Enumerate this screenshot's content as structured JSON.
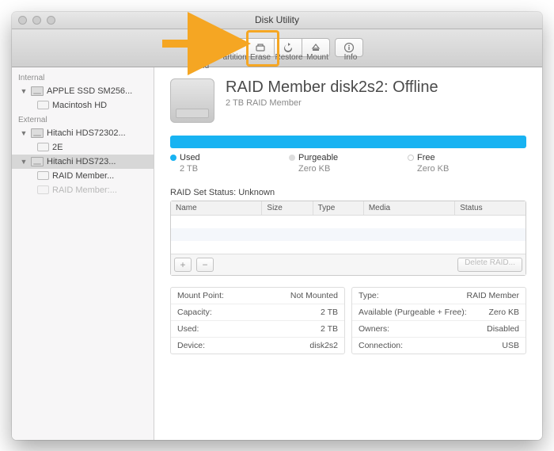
{
  "window": {
    "title": "Disk Utility"
  },
  "toolbar": {
    "items": [
      "First Aid",
      "Partition",
      "Erase",
      "Restore",
      "Mount",
      "Info"
    ]
  },
  "sidebar": {
    "sections": [
      {
        "header": "Internal",
        "items": [
          {
            "label": "APPLE SSD SM256...",
            "type": "disk",
            "children": [
              {
                "label": "Macintosh HD",
                "type": "vol"
              }
            ]
          }
        ]
      },
      {
        "header": "External",
        "items": [
          {
            "label": "Hitachi HDS72302...",
            "type": "disk",
            "children": [
              {
                "label": "2E",
                "type": "vol"
              }
            ]
          },
          {
            "label": "Hitachi HDS723...",
            "type": "disk",
            "selected": true,
            "children": [
              {
                "label": "RAID Member...",
                "type": "vol"
              },
              {
                "label": "RAID Member:...",
                "type": "vol",
                "dim": true
              }
            ]
          }
        ]
      }
    ]
  },
  "main": {
    "title": "RAID Member disk2s2: Offline",
    "subtitle": "2 TB RAID Member",
    "usage": [
      {
        "label": "Used",
        "value": "2 TB",
        "color": "#18b3f2"
      },
      {
        "label": "Purgeable",
        "value": "Zero KB",
        "color": "#dddddd"
      },
      {
        "label": "Free",
        "value": "Zero KB",
        "color": "#ffffff"
      }
    ],
    "raid_status_label": "RAID Set Status: Unknown",
    "raid_columns": [
      "Name",
      "Size",
      "Type",
      "Media",
      "Status"
    ],
    "delete_label": "Delete RAID...",
    "info_left": [
      {
        "k": "Mount Point:",
        "v": "Not Mounted"
      },
      {
        "k": "Capacity:",
        "v": "2 TB"
      },
      {
        "k": "Used:",
        "v": "2 TB"
      },
      {
        "k": "Device:",
        "v": "disk2s2"
      }
    ],
    "info_right": [
      {
        "k": "Type:",
        "v": "RAID Member"
      },
      {
        "k": "Available (Purgeable + Free):",
        "v": "Zero KB"
      },
      {
        "k": "Owners:",
        "v": "Disabled"
      },
      {
        "k": "Connection:",
        "v": "USB"
      }
    ]
  }
}
